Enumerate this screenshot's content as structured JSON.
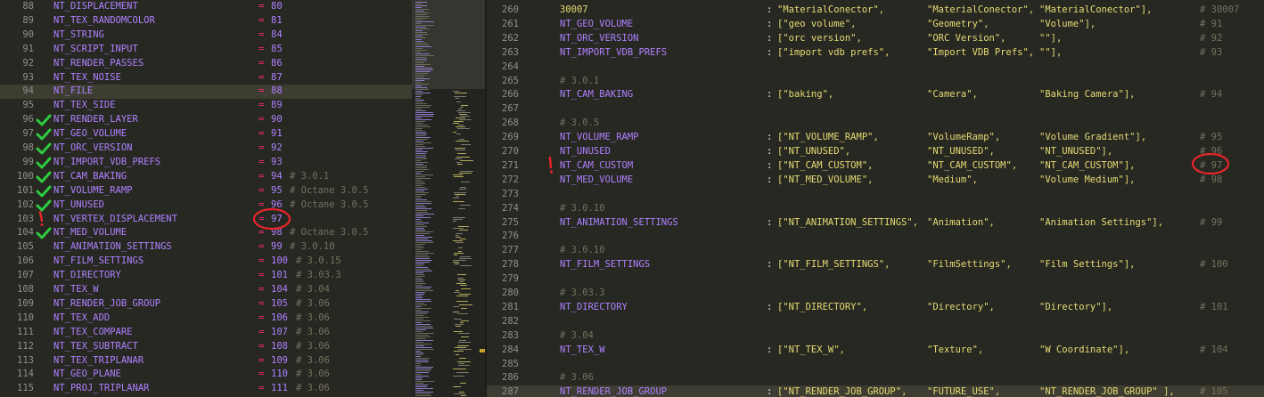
{
  "left_pane": {
    "rows": [
      {
        "ln": "88",
        "name": "NT_DISPLACEMENT",
        "num": "80",
        "comment": "",
        "check": false
      },
      {
        "ln": "89",
        "name": "NT_TEX_RANDOMCOLOR",
        "num": "81",
        "comment": "",
        "check": false
      },
      {
        "ln": "90",
        "name": "NT_STRING",
        "num": "84",
        "comment": "",
        "check": false
      },
      {
        "ln": "91",
        "name": "NT_SCRIPT_INPUT",
        "num": "85",
        "comment": "",
        "check": false
      },
      {
        "ln": "92",
        "name": "NT_RENDER_PASSES",
        "num": "86",
        "comment": "",
        "check": false
      },
      {
        "ln": "93",
        "name": "NT_TEX_NOISE",
        "num": "87",
        "comment": "",
        "check": false
      },
      {
        "ln": "94",
        "name": "NT_FILE",
        "num": "88",
        "comment": "",
        "check": false,
        "highlight": true
      },
      {
        "ln": "95",
        "name": "NT_TEX_SIDE",
        "num": "89",
        "comment": "",
        "check": false
      },
      {
        "ln": "96",
        "name": "NT_RENDER_LAYER",
        "num": "90",
        "comment": "",
        "check": true
      },
      {
        "ln": "97",
        "name": "NT_GEO_VOLUME",
        "num": "91",
        "comment": "",
        "check": true
      },
      {
        "ln": "98",
        "name": "NT_ORC_VERSION",
        "num": "92",
        "comment": "",
        "check": true
      },
      {
        "ln": "99",
        "name": "NT_IMPORT_VDB_PREFS",
        "num": "93",
        "comment": "",
        "check": true
      },
      {
        "ln": "100",
        "name": "NT_CAM_BAKING",
        "num": "94",
        "comment": "# 3.0.1",
        "check": true
      },
      {
        "ln": "101",
        "name": "NT_VOLUME_RAMP",
        "num": "95",
        "comment": "# Octane 3.0.5",
        "check": true
      },
      {
        "ln": "102",
        "name": "NT_UNUSED",
        "num": "96",
        "comment": "# Octane 3.0.5",
        "check": true
      },
      {
        "ln": "103",
        "name": "NT_VERTEX_DISPLACEMENT",
        "num": "97",
        "comment": "",
        "check": false,
        "exclaim": true
      },
      {
        "ln": "104",
        "name": "NT_MED_VOLUME",
        "num": "98",
        "comment": "# Octane 3.0.5",
        "check": true
      },
      {
        "ln": "105",
        "name": "NT_ANIMATION_SETTINGS",
        "num": "99",
        "comment": "# 3.0.10",
        "check": false
      },
      {
        "ln": "106",
        "name": "NT_FILM_SETTINGS",
        "num": "100",
        "comment": "# 3.0.15",
        "check": false
      },
      {
        "ln": "107",
        "name": "NT_DIRECTORY",
        "num": "101",
        "comment": "# 3.03.3",
        "check": false
      },
      {
        "ln": "108",
        "name": "NT_TEX_W",
        "num": "104",
        "comment": "# 3.04",
        "check": false
      },
      {
        "ln": "109",
        "name": "NT_RENDER_JOB_GROUP",
        "num": "105",
        "comment": "# 3.06",
        "check": false
      },
      {
        "ln": "110",
        "name": "NT_TEX_ADD",
        "num": "106",
        "comment": "# 3.06",
        "check": false
      },
      {
        "ln": "111",
        "name": "NT_TEX_COMPARE",
        "num": "107",
        "comment": "# 3.06",
        "check": false
      },
      {
        "ln": "112",
        "name": "NT_TEX_SUBTRACT",
        "num": "108",
        "comment": "# 3.06",
        "check": false
      },
      {
        "ln": "113",
        "name": "NT_TEX_TRIPLANAR",
        "num": "109",
        "comment": "# 3.06",
        "check": false
      },
      {
        "ln": "114",
        "name": "NT_GEO_PLANE",
        "num": "110",
        "comment": "# 3.06",
        "check": false
      },
      {
        "ln": "115",
        "name": "NT_PROJ_TRIPLANAR",
        "num": "111",
        "comment": "# 3.06",
        "check": false
      }
    ]
  },
  "right_pane": {
    "rows": [
      {
        "ln": "260",
        "kind": "entry",
        "key": "30007",
        "s1": "\"MaterialConector\",",
        "s2": "\"MaterialConector\",",
        "s3": "\"MaterialConector\"],",
        "comment": "# 30007",
        "keystyle": "str"
      },
      {
        "ln": "261",
        "kind": "entry",
        "key": "NT_GEO_VOLUME",
        "s1": "[\"geo volume\",",
        "s2": "\"Geometry\",",
        "s3": "\"Volume\"],",
        "comment": "# 91"
      },
      {
        "ln": "262",
        "kind": "entry",
        "key": "NT_ORC_VERSION",
        "s1": "[\"orc version\",",
        "s2": "\"ORC Version\",",
        "s3": "\"\"],",
        "comment": "# 92"
      },
      {
        "ln": "263",
        "kind": "entry",
        "key": "NT_IMPORT_VDB_PREFS",
        "s1": "[\"import vdb prefs\",",
        "s2": "\"Import VDB Prefs\",",
        "s3": "\"\"],",
        "comment": "# 93"
      },
      {
        "ln": "264",
        "kind": "blank"
      },
      {
        "ln": "265",
        "kind": "comment",
        "text": "# 3.0.1"
      },
      {
        "ln": "266",
        "kind": "entry",
        "key": "NT_CAM_BAKING",
        "s1": "[\"baking\",",
        "s2": "\"Camera\",",
        "s3": "\"Baking Camera\"],",
        "comment": "# 94"
      },
      {
        "ln": "267",
        "kind": "blank"
      },
      {
        "ln": "268",
        "kind": "comment",
        "text": "# 3.0.5"
      },
      {
        "ln": "269",
        "kind": "entry",
        "key": "NT_VOLUME_RAMP",
        "s1": "[\"NT_VOLUME_RAMP\",",
        "s2": "\"VolumeRamp\",",
        "s3": "\"Volume Gradient\"],",
        "comment": "# 95"
      },
      {
        "ln": "270",
        "kind": "entry",
        "key": "NT_UNUSED",
        "s1": "[\"NT_UNUSED\",",
        "s2": "\"NT_UNUSED\",",
        "s3": "\"NT_UNUSED\"],",
        "comment": "# 96"
      },
      {
        "ln": "271",
        "kind": "entry",
        "key": "NT_CAM_CUSTOM",
        "s1": "[\"NT_CAM_CUSTOM\",",
        "s2": "\"NT_CAM_CUSTOM\",",
        "s3": "\"NT_CAM_CUSTOM\"],",
        "comment": "# 97",
        "mark": true
      },
      {
        "ln": "272",
        "kind": "entry",
        "key": "NT_MED_VOLUME",
        "s1": "[\"NT_MED_VOLUME\",",
        "s2": "\"Medium\",",
        "s3": "\"Volume Medium\"],",
        "comment": "# 98"
      },
      {
        "ln": "273",
        "kind": "blank"
      },
      {
        "ln": "274",
        "kind": "comment",
        "text": "# 3.0.10"
      },
      {
        "ln": "275",
        "kind": "entry",
        "key": "NT_ANIMATION_SETTINGS",
        "s1": "[\"NT_ANIMATION_SETTINGS\",",
        "s2": "\"Animation\",",
        "s3": "\"Animation Settings\"],",
        "comment": "# 99"
      },
      {
        "ln": "276",
        "kind": "blank"
      },
      {
        "ln": "277",
        "kind": "comment",
        "text": "# 3.0.10"
      },
      {
        "ln": "278",
        "kind": "entry",
        "key": "NT_FILM_SETTINGS",
        "s1": "[\"NT_FILM_SETTINGS\",",
        "s2": "\"FilmSettings\",",
        "s3": "\"Film Settings\"],",
        "comment": "# 100"
      },
      {
        "ln": "279",
        "kind": "blank"
      },
      {
        "ln": "280",
        "kind": "comment",
        "text": "# 3.03.3"
      },
      {
        "ln": "281",
        "kind": "entry",
        "key": "NT_DIRECTORY",
        "s1": "[\"NT_DIRECTORY\",",
        "s2": "\"Directory\",",
        "s3": "\"Directory\"],",
        "comment": "# 101"
      },
      {
        "ln": "282",
        "kind": "blank"
      },
      {
        "ln": "283",
        "kind": "comment",
        "text": "# 3.04"
      },
      {
        "ln": "284",
        "kind": "entry",
        "key": "NT_TEX_W",
        "s1": "[\"NT_TEX_W\",",
        "s2": "\"Texture\",",
        "s3": "\"W Coordinate\"],",
        "comment": "# 104"
      },
      {
        "ln": "285",
        "kind": "blank"
      },
      {
        "ln": "286",
        "kind": "comment",
        "text": "# 3.06"
      },
      {
        "ln": "287",
        "kind": "entry",
        "key": "NT_RENDER_JOB_GROUP",
        "s1": "[\"NT_RENDER_JOB_GROUP\",",
        "s2": "\"FUTURE_USE\",",
        "s3": "\"NT_RENDER_JOB_GROUP\" ],",
        "comment": "# 105",
        "highlight": true
      }
    ]
  },
  "colors": {
    "background": "#272822",
    "keyword_purple": "#ae81ff",
    "operator_pink": "#f92672",
    "string_yellow": "#e6db74",
    "comment_gray": "#75715e",
    "checkmark_green": "#2ecc40",
    "annotation_red": "#e8252a"
  }
}
